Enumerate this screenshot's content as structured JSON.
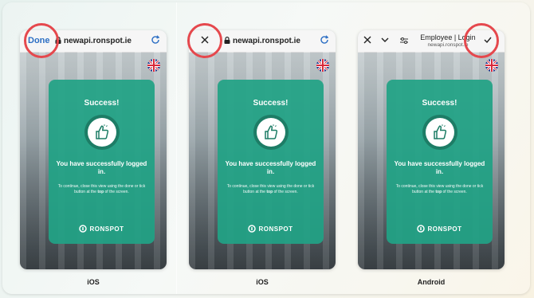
{
  "panels": [
    {
      "platform_label": "iOS",
      "close_control": "Done",
      "url": "newapi.ronspot.ie",
      "card": {
        "heading": "Success!",
        "message": "You have successfully logged in.",
        "hint_prefix": "To continue, close this view using the done or tick button at the ",
        "hint_bold": "top",
        "hint_suffix": " of the screen.",
        "brand": "RONSPOT"
      }
    },
    {
      "platform_label": "iOS",
      "close_control": "close-x-icon",
      "url": "newapi.ronspot.ie",
      "card": {
        "heading": "Success!",
        "message": "You have successfully logged in.",
        "hint_prefix": "To continue, close this view using the done or tick button at the ",
        "hint_bold": "top",
        "hint_suffix": " of the screen.",
        "brand": "RONSPOT"
      }
    },
    {
      "platform_label": "Android",
      "close_control": "check-icon",
      "page_title": "Employee | Login",
      "url": "newapi.ronspot.ie",
      "card": {
        "heading": "Success!",
        "message": "You have successfully logged in.",
        "hint_prefix": "To continue, close this view using the done or tick button at the ",
        "hint_bold": "top",
        "hint_suffix": " of the screen.",
        "brand": "RONSPOT"
      }
    }
  ],
  "colors": {
    "card_green": "#21a385",
    "highlight_ring": "#e5484d",
    "ios_link_blue": "#2d6fc4"
  }
}
